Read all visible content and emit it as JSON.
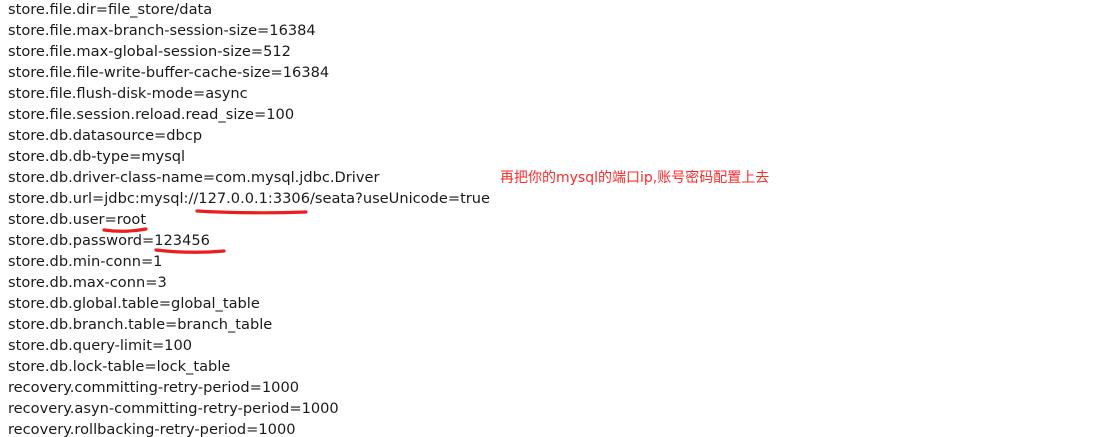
{
  "config_lines": [
    "store.file.dir=file_store/data",
    "store.file.max-branch-session-size=16384",
    "store.file.max-global-session-size=512",
    "store.file.file-write-buffer-cache-size=16384",
    "store.file.flush-disk-mode=async",
    "store.file.session.reload.read_size=100",
    "store.db.datasource=dbcp",
    "store.db.db-type=mysql",
    "store.db.driver-class-name=com.mysql.jdbc.Driver",
    "store.db.url=jdbc:mysql://127.0.0.1:3306/seata?useUnicode=true",
    "store.db.user=root",
    "store.db.password=123456",
    "store.db.min-conn=1",
    "store.db.max-conn=3",
    "store.db.global.table=global_table",
    "store.db.branch.table=branch_table",
    "store.db.query-limit=100",
    "store.db.lock-table=lock_table",
    "recovery.committing-retry-period=1000",
    "recovery.asyn-committing-retry-period=1000",
    "recovery.rollbacking-retry-period=1000"
  ],
  "annotation": {
    "text": "再把你的mysql的端口ip,账号密码配置上去",
    "color": "#ff2a2a"
  },
  "colors": {
    "text": "#1a1a1a",
    "background": "#ffffff",
    "markup": "#ee1c1c"
  }
}
